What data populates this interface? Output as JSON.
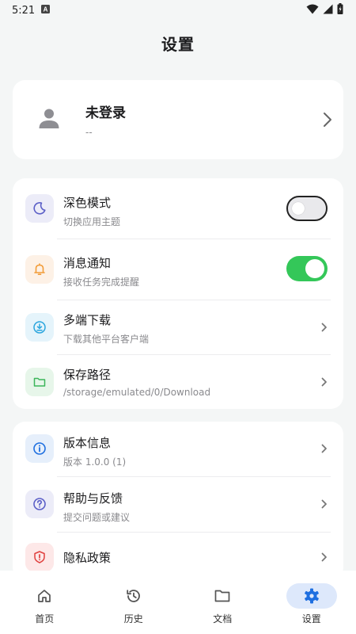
{
  "status_bar": {
    "time": "5:21"
  },
  "header": {
    "title": "设置"
  },
  "profile": {
    "name": "未登录",
    "subtitle": "--"
  },
  "settings_group": [
    {
      "title": "深色模式",
      "subtitle": "切换应用主题",
      "icon": "moon-icon",
      "control": "toggle",
      "enabled": false
    },
    {
      "title": "消息通知",
      "subtitle": "接收任务完成提醒",
      "icon": "bell-icon",
      "control": "toggle",
      "enabled": true
    },
    {
      "title": "多端下载",
      "subtitle": "下载其他平台客户端",
      "icon": "download-icon",
      "control": "chevron"
    },
    {
      "title": "保存路径",
      "subtitle": "/storage/emulated/0/Download",
      "icon": "folder-icon",
      "control": "chevron"
    }
  ],
  "about_group": [
    {
      "title": "版本信息",
      "subtitle": "版本 1.0.0 (1)",
      "icon": "info-icon"
    },
    {
      "title": "帮助与反馈",
      "subtitle": "提交问题或建议",
      "icon": "help-icon"
    },
    {
      "title": "隐私政策",
      "icon": "shield-icon"
    }
  ],
  "bottom_nav": [
    {
      "label": "首页",
      "icon": "home-icon",
      "active": false
    },
    {
      "label": "历史",
      "icon": "history-icon",
      "active": false
    },
    {
      "label": "文档",
      "icon": "folder-icon",
      "active": false
    },
    {
      "label": "设置",
      "icon": "gear-icon",
      "active": true
    }
  ],
  "colors": {
    "accent": "#1e6fe0",
    "toggle_on": "#34c759",
    "background": "#f4f6f6"
  }
}
